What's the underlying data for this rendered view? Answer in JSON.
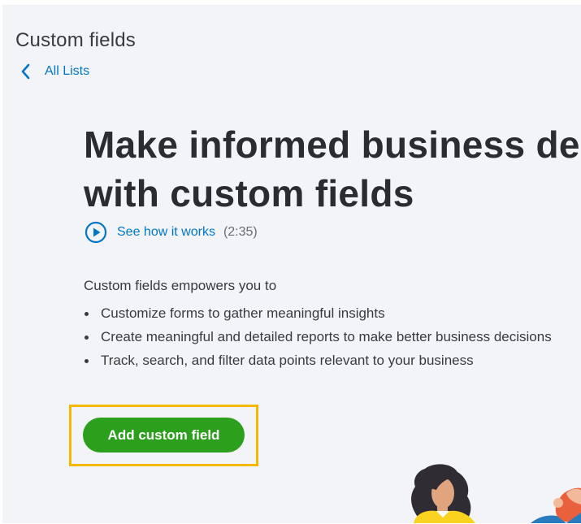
{
  "header": {
    "title": "Custom fields",
    "breadcrumb_label": "All Lists"
  },
  "hero": {
    "heading_line1": "Make informed business decisions",
    "heading_line2": "with custom fields"
  },
  "video": {
    "link_label": "See how it works",
    "duration": "(2:35)"
  },
  "benefits": {
    "intro": "Custom fields empowers you to",
    "items": [
      "Customize forms to gather meaningful insights",
      "Create meaningful and detailed reports to make better business decisions",
      "Track, search, and filter data points relevant to your business"
    ]
  },
  "actions": {
    "add_label": "Add custom field"
  },
  "colors": {
    "page_background": "#f3f4f8",
    "link_blue": "#0077c5",
    "primary_green": "#2ca01c",
    "highlight_yellow": "#f5b800",
    "text_dark": "#393a3d"
  },
  "icons": {
    "back": "chevron-left-icon",
    "video": "play-circle-icon"
  }
}
